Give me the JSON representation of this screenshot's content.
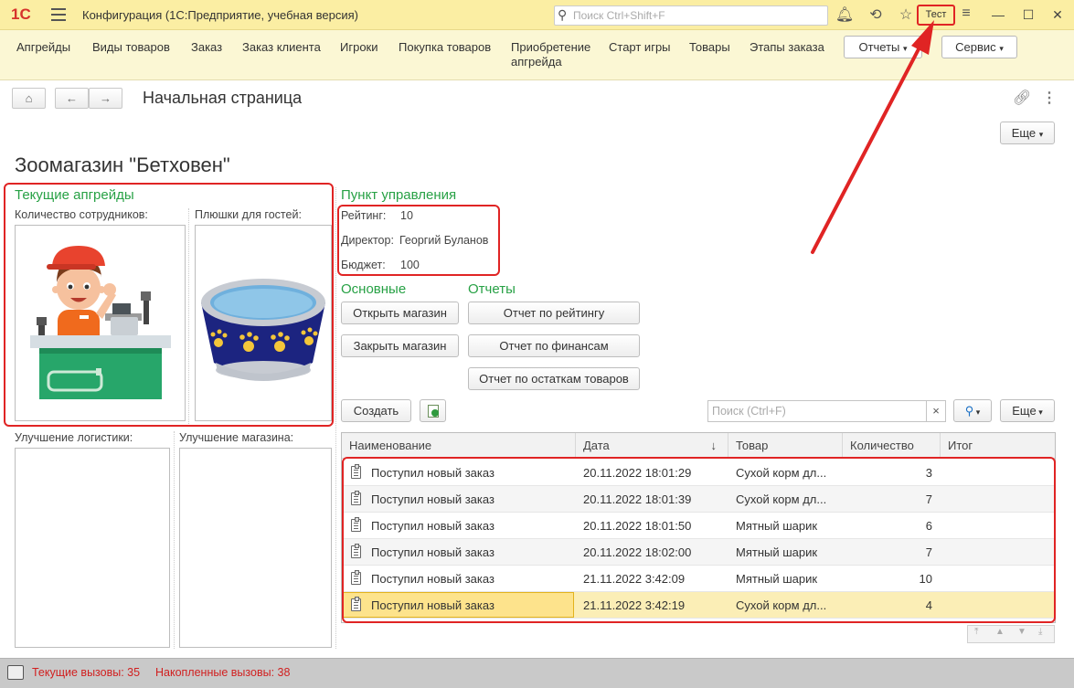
{
  "app": {
    "logo": "1С",
    "title": "Конфигурация  (1С:Предприятие, учебная версия)",
    "search_placeholder": "Поиск Ctrl+Shift+F",
    "test_label": "Тест"
  },
  "sections": {
    "items": [
      "Апгрейды",
      "Виды товаров",
      "Заказ",
      "Заказ клиента",
      "Игроки",
      "Покупка товаров",
      "Приобретение апгрейда",
      "Старт игры",
      "Товары",
      "Этапы заказа"
    ],
    "reports_label": "Отчеты",
    "service_label": "Сервис"
  },
  "page": {
    "title": "Начальная страница",
    "more_label": "Еще",
    "shop_title": "Зоомагазин \"Бетховен\""
  },
  "upgrades": {
    "heading": "Текущие апгрейды",
    "staff_label": "Количество сотрудников:",
    "snacks_label": "Плюшки для гостей:",
    "logistics_label": "Улучшение логистики:",
    "store_label": "Улучшение магазина:"
  },
  "control": {
    "heading": "Пункт управления",
    "rating_label": "Рейтинг:",
    "rating_value": "10",
    "director_label": "Директор:",
    "director_value": "Георгий Буланов",
    "budget_label": "Бюджет:",
    "budget_value": "100"
  },
  "main_actions": {
    "heading": "Основные",
    "open_shop": "Открыть магазин",
    "close_shop": "Закрыть магазин"
  },
  "reports": {
    "heading": "Отчеты",
    "by_rating": "Отчет по рейтингу",
    "by_finance": "Отчет по финансам",
    "by_stock": "Отчет по остаткам товаров"
  },
  "list": {
    "create_label": "Создать",
    "search_placeholder": "Поиск (Ctrl+F)",
    "clear_symbol": "×",
    "more_label": "Еще",
    "columns": [
      "Наименование",
      "Дата",
      "Товар",
      "Количество",
      "Итог"
    ],
    "sort_indicator": "↓",
    "rows": [
      [
        "Поступил новый заказ",
        "20.11.2022 18:01:29",
        "Сухой корм дл...",
        "3",
        ""
      ],
      [
        "Поступил новый заказ",
        "20.11.2022 18:01:39",
        "Сухой корм дл...",
        "7",
        ""
      ],
      [
        "Поступил новый заказ",
        "20.11.2022 18:01:50",
        "Мятный шарик",
        "6",
        ""
      ],
      [
        "Поступил новый заказ",
        "20.11.2022 18:02:00",
        "Мятный шарик",
        "7",
        ""
      ],
      [
        "Поступил новый заказ",
        "21.11.2022 3:42:09",
        "Мятный шарик",
        "10",
        ""
      ],
      [
        "Поступил новый заказ",
        "21.11.2022 3:42:19",
        "Сухой корм дл...",
        "4",
        ""
      ]
    ],
    "selected_row": 5
  },
  "status": {
    "current_calls": "Текущие вызовы: 35",
    "accumulated_calls": "Накопленные вызовы: 38"
  },
  "colors": {
    "header_bg": "#fbeea3",
    "section_bg": "#fbf7d4",
    "group_heading": "#27a145",
    "highlight_red": "#e02424",
    "selected_row": "#fbeeb6",
    "status_text": "#d11f1f"
  }
}
